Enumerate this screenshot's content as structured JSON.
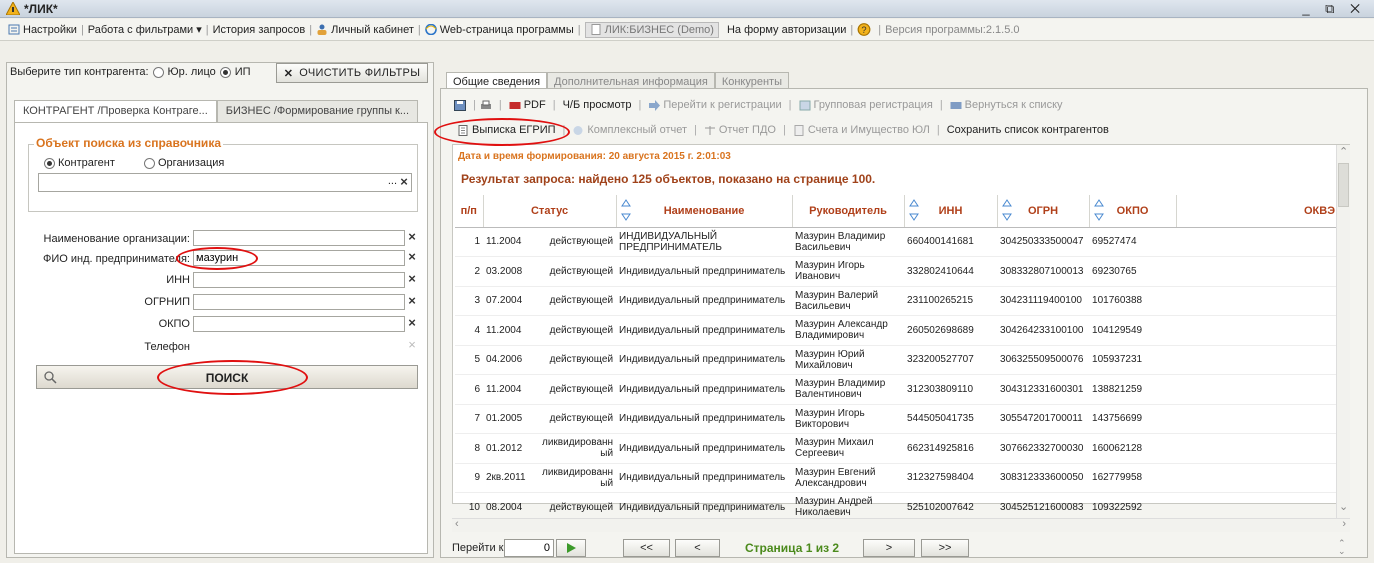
{
  "window": {
    "title": "*ЛИК*",
    "controls": "_ ⧉ ✕"
  },
  "menubar": {
    "settings": "Настройки",
    "filters": "Работа с фильтрами ▾",
    "history": "История запросов",
    "cabinet": "Личный кабинет",
    "web": "Web-страница программы",
    "demo": "ЛИК:БИЗНЕС (Demo)",
    "auth": "На форму авторизации",
    "version": "Версия программы:2.1.5.0"
  },
  "left": {
    "type_label": "Выберите тип контрагента:",
    "type_options": [
      "Юр. лицо",
      "ИП"
    ],
    "clear_filters": "ОЧИСТИТЬ ФИЛЬТРЫ",
    "tabs": [
      "КОНТРАГЕНТ /Проверка Контраге...",
      "БИЗНЕС /Формирование группы к..."
    ],
    "search_object": {
      "legend": "Объект поиска из справочника",
      "options": [
        "Контрагент",
        "Организация"
      ],
      "dots": "..."
    },
    "fields": {
      "org_name": {
        "label": "Наименование организации:",
        "value": ""
      },
      "fio": {
        "label": "ФИО инд. предпринимателя:",
        "value": "мазурин"
      },
      "inn": {
        "label": "ИНН",
        "value": ""
      },
      "ogrnip": {
        "label": "ОГРНИП",
        "value": ""
      },
      "okpo": {
        "label": "ОКПО",
        "value": ""
      },
      "phone": {
        "label": "Телефон",
        "value": ""
      }
    },
    "search_button": "ПОИСК"
  },
  "right": {
    "tabs": [
      "Общие сведения",
      "Дополнительная информация",
      "Конкуренты"
    ],
    "toolbar1": {
      "pdf": "PDF",
      "bw": "Ч/Б просмотр",
      "goto_reg": "Перейти к регистрации",
      "group_reg": "Групповая регистрация",
      "back": "Вернуться к списку"
    },
    "toolbar2": {
      "egrip": "Выписка ЕГРИП",
      "complex": "Комплексный отчет",
      "pdo": "Отчет ПДО",
      "accounts": "Счета и Имущество ЮЛ",
      "save_list": "Сохранить список контрагентов"
    },
    "datetime": "Дата и время формирования: 20 августа 2015 г. 2:01:03",
    "result": "Результат запроса: найдено 125 объектов, показано на странице 100.",
    "columns": [
      "п/п",
      "Статус",
      "Наименование",
      "Руководитель",
      "ИНН",
      "ОГРН",
      "ОКПО",
      "ОКВЭ"
    ],
    "rows": [
      [
        "1",
        "11.2004",
        "действующей",
        "ИНДИВИДУАЛЬНЫЙ ПРЕДПРИНИМАТЕЛЬ",
        "Мазурин Владимир Васильевич",
        "660400141681",
        "304250333500047",
        "69527474"
      ],
      [
        "2",
        "03.2008",
        "действующей",
        "Индивидуальный предприниматель",
        "Мазурин Игорь Иванович",
        "332802410644",
        "308332807100013",
        "69230765"
      ],
      [
        "3",
        "07.2004",
        "действующей",
        "Индивидуальный предприниматель",
        "Мазурин Валерий Васильевич",
        "231100265215",
        "304231119400100",
        "101760388"
      ],
      [
        "4",
        "11.2004",
        "действующей",
        "Индивидуальный предприниматель",
        "Мазурин Александр Владимирович",
        "260502698689",
        "304264233100100",
        "104129549"
      ],
      [
        "5",
        "04.2006",
        "действующей",
        "Индивидуальный предприниматель",
        "Мазурин Юрий Михайлович",
        "323200527707",
        "306325509500076",
        "105937231"
      ],
      [
        "6",
        "11.2004",
        "действующей",
        "Индивидуальный предприниматель",
        "Мазурин Владимир Валентинович",
        "312303809110",
        "304312331600301",
        "138821259"
      ],
      [
        "7",
        "01.2005",
        "действующей",
        "Индивидуальный предприниматель",
        "Мазурин Игорь Викторович",
        "544505041735",
        "305547201700011",
        "143756699"
      ],
      [
        "8",
        "01.2012",
        "ликвидированн ый",
        "Индивидуальный предприниматель",
        "Мазурин Михаил Сергеевич",
        "662314925816",
        "307662332700030",
        "160062128"
      ],
      [
        "9",
        "2кв.2011",
        "ликвидированн ый",
        "Индивидуальный предприниматель",
        "Мазурин Евгений Александрович",
        "312327598404",
        "308312333600050",
        "162779958"
      ],
      [
        "10",
        "08.2004",
        "действующей",
        "Индивидуальный предприниматель",
        "Мазурин Андрей Николаевич",
        "525102007642",
        "304525121600083",
        "109322592"
      ]
    ],
    "pager": {
      "goto_label": "Перейти к:",
      "goto_value": "0",
      "first": "<<",
      "prev": "<",
      "info": "Страница 1 из 2",
      "next": ">",
      "last": ">>"
    }
  }
}
